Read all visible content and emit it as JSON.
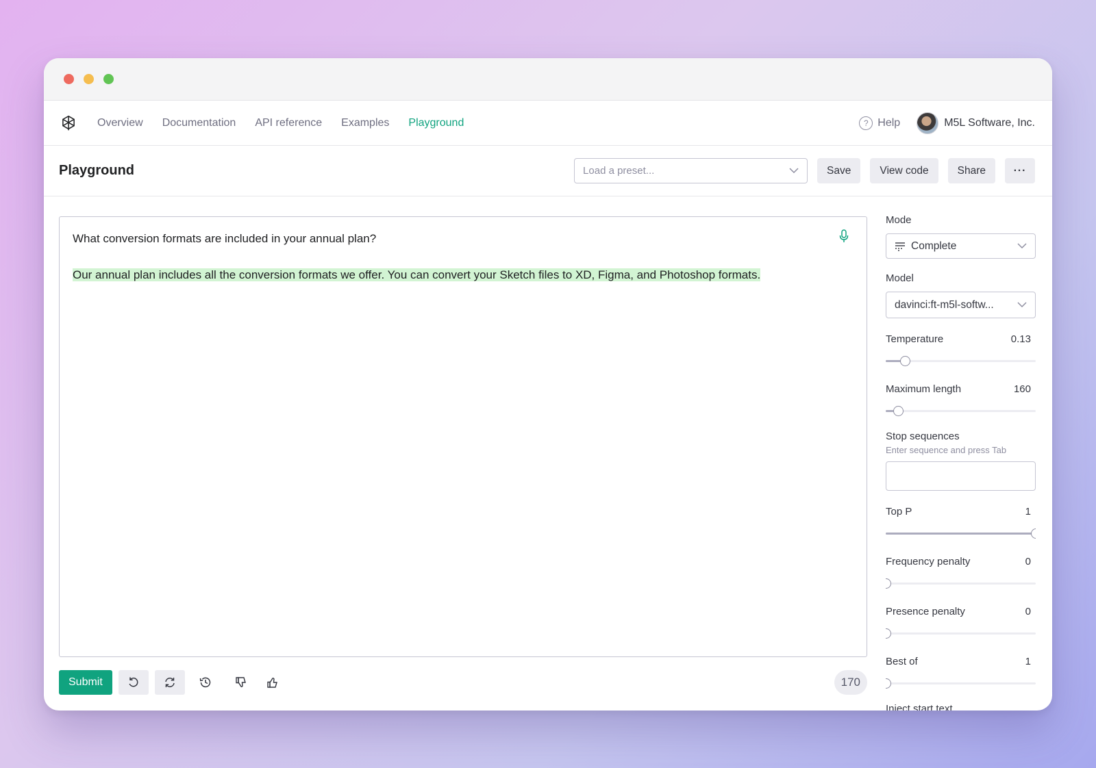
{
  "nav": {
    "links": [
      "Overview",
      "Documentation",
      "API reference",
      "Examples",
      "Playground"
    ],
    "help_label": "Help",
    "org_name": "M5L Software, Inc."
  },
  "page": {
    "title": "Playground",
    "preset_placeholder": "Load a preset...",
    "save_label": "Save",
    "view_code_label": "View code",
    "share_label": "Share",
    "more_label": "···"
  },
  "editor": {
    "prompt": "What conversion formats are included in your annual plan?",
    "completion": "Our annual plan includes all the conversion formats we offer. You can convert your Sketch files to XD, Figma, and Photoshop formats."
  },
  "bottom": {
    "submit_label": "Submit",
    "token_count": "170"
  },
  "settings": {
    "mode_label": "Mode",
    "mode_value": "Complete",
    "model_label": "Model",
    "model_value": "davinci:ft-m5l-softw...",
    "temperature": {
      "label": "Temperature",
      "value": "0.13",
      "fraction": 0.13
    },
    "max_length": {
      "label": "Maximum length",
      "value": "160",
      "fraction": 0.08
    },
    "stop_label": "Stop sequences",
    "stop_hint": "Enter sequence and press Tab",
    "top_p": {
      "label": "Top P",
      "value": "1",
      "fraction": 1.0
    },
    "frequency_penalty": {
      "label": "Frequency penalty",
      "value": "0",
      "fraction": 0.0
    },
    "presence_penalty": {
      "label": "Presence penalty",
      "value": "0",
      "fraction": 0.0
    },
    "best_of": {
      "label": "Best of",
      "value": "1",
      "fraction": 0.0
    },
    "inject_label": "Inject start text"
  },
  "colors": {
    "accent": "#10a37f",
    "highlight": "#d2f4d3"
  }
}
